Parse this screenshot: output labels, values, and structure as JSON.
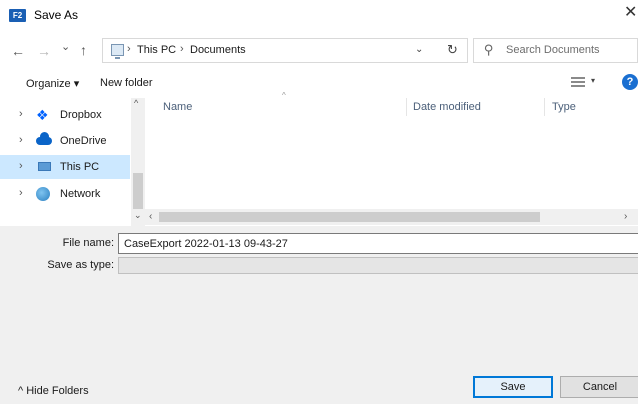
{
  "window": {
    "title": "Save As",
    "app_icon_text": "F2",
    "close_glyph": "✕",
    "accent_color": "#0078d7"
  },
  "nav": {
    "back_glyph": "←",
    "forward_glyph": "→",
    "recent_glyph": "⌄",
    "up_glyph": "↑"
  },
  "address": {
    "breadcrumbs": [
      "This PC",
      "Documents"
    ],
    "separator": "›",
    "dropdown_glyph": "⌄",
    "refresh_glyph": "↻"
  },
  "search": {
    "placeholder": "Search Documents"
  },
  "toolbar": {
    "organize_label": "Organize ▾",
    "new_folder_label": "New folder",
    "view_dropdown_glyph": "▾",
    "help_label": "?"
  },
  "sidebar": {
    "items": [
      {
        "label": "Dropbox",
        "icon": "dropbox-icon",
        "chevron": "›"
      },
      {
        "label": "OneDrive",
        "icon": "onedrive-icon",
        "chevron": "›"
      },
      {
        "label": "This PC",
        "icon": "this-pc-icon",
        "chevron": "›",
        "selected": true
      },
      {
        "label": "Network",
        "icon": "network-icon",
        "chevron": "›"
      }
    ],
    "dropbox_glyph": "❖"
  },
  "file_list": {
    "columns": [
      "Name",
      "Date modified",
      "Type"
    ],
    "sort_caret": "^",
    "rows": []
  },
  "scrollbars": {
    "up_arrow": "^",
    "down_arrow": "⌄",
    "left_arrow": "‹",
    "right_arrow": "›"
  },
  "form": {
    "file_name_label": "File name:",
    "file_name_value": "CaseExport 2022-01-13 09-43-27",
    "save_as_type_label": "Save as type:",
    "save_as_type_value": "",
    "select_arrow": "⌄"
  },
  "footer": {
    "hide_folders_label": "^  Hide Folders",
    "save_label": "Save",
    "cancel_label": "Cancel"
  }
}
